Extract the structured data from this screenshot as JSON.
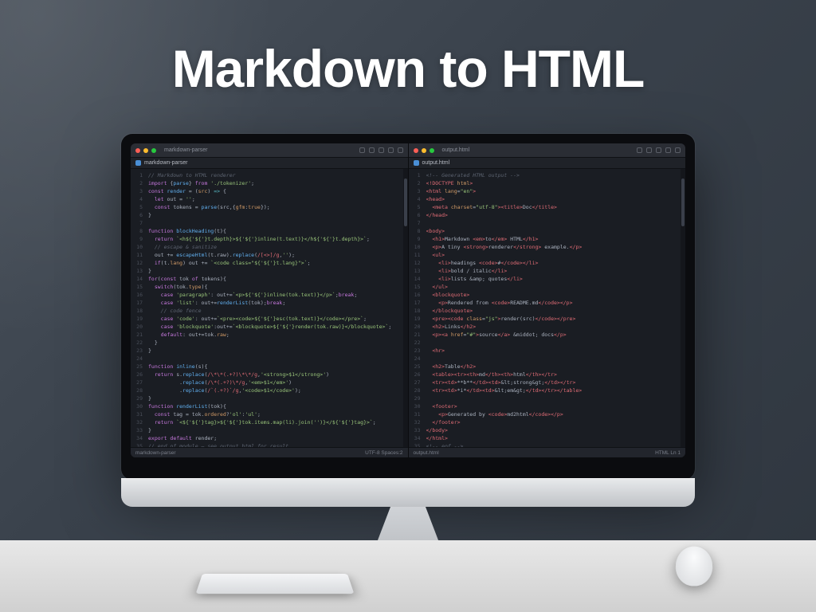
{
  "hero_title": "Markdown to HTML",
  "left_pane": {
    "tab_label": "markdown-parser",
    "status_left": "markdown-parser",
    "status_right": "UTF-8  Spaces:2",
    "lines": [
      {
        "n": 1,
        "t": "<span class='cm'>// Markdown to HTML renderer</span>"
      },
      {
        "n": 2,
        "t": "<span class='kw'>import</span> {<span class='fn'>parse</span>} <span class='kw'>from</span> <span class='str'>'./tokenizer'</span>;"
      },
      {
        "n": 3,
        "t": "<span class='kw'>const</span> <span class='fn'>render</span> = (<span class='attr'>src</span>) <span class='op'>=&gt;</span> {"
      },
      {
        "n": 4,
        "t": "  <span class='kw'>let</span> out = <span class='str'>''</span>;"
      },
      {
        "n": 5,
        "t": "  <span class='kw'>const</span> tokens = <span class='fn'>parse</span>(src,{<span class='attr'>gfm</span>:<span class='num'>true</span>});"
      },
      {
        "n": 6,
        "t": "}"
      },
      {
        "n": 7,
        "t": ""
      },
      {
        "n": 8,
        "t": "<span class='kw'>function</span> <span class='fn'>blockHeading</span>(t){"
      },
      {
        "n": 9,
        "t": "  <span class='kw'>return</span> <span class='str'>`&lt;h${'${'}t.depth}&gt;${'${'}inline(t.text)}&lt;/h${'${'}t.depth}&gt;`</span>;"
      },
      {
        "n": 10,
        "t": "  <span class='cm'>// escape &amp; sanitize</span>"
      },
      {
        "n": 11,
        "t": "  out += <span class='fn'>escapeHtml</span>(t.raw).<span class='fn'>replace</span>(<span class='tag'>/[&lt;&gt;]/g</span>,<span class='str'>''</span>);"
      },
      {
        "n": 12,
        "t": "  <span class='kw'>if</span>(t.<span class='attr'>lang</span>) out += <span class='str'>`&lt;code class=&quot;${'${'}t.lang}&quot;&gt;`</span>;"
      },
      {
        "n": 13,
        "t": "}"
      },
      {
        "n": 14,
        "t": "<span class='kw'>for</span>(<span class='kw'>const</span> tok <span class='kw'>of</span> tokens){"
      },
      {
        "n": 15,
        "t": "  <span class='kw'>switch</span>(tok.<span class='attr'>type</span>){"
      },
      {
        "n": 16,
        "t": "    <span class='kw'>case</span> <span class='str'>'paragraph'</span>: out+=<span class='str'>`&lt;p&gt;${'${'}inline(tok.text)}&lt;/p&gt;`</span>;<span class='kw'>break</span>;"
      },
      {
        "n": 17,
        "t": "    <span class='kw'>case</span> <span class='str'>'list'</span>: out+=<span class='fn'>renderList</span>(tok);<span class='kw'>break</span>;"
      },
      {
        "n": 18,
        "t": "    <span class='cm'>// code fence</span>"
      },
      {
        "n": 19,
        "t": "    <span class='kw'>case</span> <span class='str'>'code'</span>: out+=<span class='str'>`&lt;pre&gt;&lt;code&gt;${'${'}esc(tok.text)}&lt;/code&gt;&lt;/pre&gt;`</span>;"
      },
      {
        "n": 20,
        "t": "    <span class='kw'>case</span> <span class='str'>'blockquote'</span>:out+=<span class='str'>`&lt;blockquote&gt;${'${'}render(tok.raw)}&lt;/blockquote&gt;`</span>;"
      },
      {
        "n": 21,
        "t": "    <span class='kw'>default</span>: out+=tok.<span class='attr'>raw</span>;"
      },
      {
        "n": 22,
        "t": "  }"
      },
      {
        "n": 23,
        "t": "}"
      },
      {
        "n": 24,
        "t": ""
      },
      {
        "n": 25,
        "t": "<span class='kw'>function</span> <span class='fn'>inline</span>(s){"
      },
      {
        "n": 26,
        "t": "  <span class='kw'>return</span> s.<span class='fn'>replace</span>(<span class='tag'>/\\*\\*(.+?)\\*\\*/g</span>,<span class='str'>'&lt;strong&gt;$1&lt;/strong&gt;'</span>)"
      },
      {
        "n": 27,
        "t": "          .<span class='fn'>replace</span>(<span class='tag'>/\\*(.+?)\\*/g</span>,<span class='str'>'&lt;em&gt;$1&lt;/em&gt;'</span>)"
      },
      {
        "n": 28,
        "t": "          .<span class='fn'>replace</span>(<span class='tag'>/`(.+?)`/g</span>,<span class='str'>'&lt;code&gt;$1&lt;/code&gt;'</span>);"
      },
      {
        "n": 29,
        "t": "}"
      },
      {
        "n": 30,
        "t": "<span class='kw'>function</span> <span class='fn'>renderList</span>(tok){"
      },
      {
        "n": 31,
        "t": "  <span class='kw'>const</span> tag = tok.<span class='attr'>ordered</span>?<span class='str'>'ol'</span>:<span class='str'>'ul'</span>;"
      },
      {
        "n": 32,
        "t": "  <span class='kw'>return</span> <span class='str'>`&lt;${'${'}tag}&gt;${'${'}tok.items.map(li).join('')}&lt;/${'${'}tag}&gt;`</span>;"
      },
      {
        "n": 33,
        "t": "}"
      },
      {
        "n": 34,
        "t": "<span class='kw'>export</span> <span class='kw'>default</span> render;"
      },
      {
        "n": 35,
        "t": "<span class='cm'>// end of module — see output.html for result</span>"
      }
    ]
  },
  "right_pane": {
    "tab_label": "output.html",
    "status_left": "output.html",
    "status_right": "HTML  Ln 1",
    "lines": [
      {
        "n": 1,
        "t": "<span class='cm'>&lt;!-- Generated HTML output --&gt;</span>"
      },
      {
        "n": 2,
        "t": "<span class='tag'>&lt;!DOCTYPE</span> <span class='attr'>html</span><span class='tag'>&gt;</span>"
      },
      {
        "n": 3,
        "t": "<span class='tag'>&lt;html</span> <span class='attr'>lang</span>=<span class='str'>&quot;en&quot;</span><span class='tag'>&gt;</span>"
      },
      {
        "n": 4,
        "t": "<span class='tag'>&lt;head&gt;</span>"
      },
      {
        "n": 5,
        "t": "  <span class='tag'>&lt;meta</span> <span class='attr'>charset</span>=<span class='str'>&quot;utf-8&quot;</span><span class='tag'>&gt;</span><span class='tag'>&lt;title&gt;</span>Doc<span class='tag'>&lt;/title&gt;</span>"
      },
      {
        "n": 6,
        "t": "<span class='tag'>&lt;/head&gt;</span>"
      },
      {
        "n": 7,
        "t": ""
      },
      {
        "n": 8,
        "t": "<span class='tag'>&lt;body&gt;</span>"
      },
      {
        "n": 9,
        "t": "  <span class='tag'>&lt;h1&gt;</span>Markdown <span class='tag'>&lt;em&gt;</span>to<span class='tag'>&lt;/em&gt;</span> HTML<span class='tag'>&lt;/h1&gt;</span>"
      },
      {
        "n": 10,
        "t": "  <span class='tag'>&lt;p&gt;</span>A tiny <span class='tag'>&lt;strong&gt;</span>renderer<span class='tag'>&lt;/strong&gt;</span> example.<span class='tag'>&lt;/p&gt;</span>"
      },
      {
        "n": 11,
        "t": "  <span class='tag'>&lt;ul&gt;</span>"
      },
      {
        "n": 12,
        "t": "    <span class='tag'>&lt;li&gt;</span>headings <span class='tag'>&lt;code&gt;</span>#<span class='tag'>&lt;/code&gt;</span><span class='tag'>&lt;/li&gt;</span>"
      },
      {
        "n": 13,
        "t": "    <span class='tag'>&lt;li&gt;</span>bold / italic<span class='tag'>&lt;/li&gt;</span>"
      },
      {
        "n": 14,
        "t": "    <span class='tag'>&lt;li&gt;</span>lists &amp;amp; quotes<span class='tag'>&lt;/li&gt;</span>"
      },
      {
        "n": 15,
        "t": "  <span class='tag'>&lt;/ul&gt;</span>"
      },
      {
        "n": 16,
        "t": "  <span class='tag'>&lt;blockquote&gt;</span>"
      },
      {
        "n": 17,
        "t": "    <span class='tag'>&lt;p&gt;</span>Rendered from <span class='tag'>&lt;code&gt;</span>README.md<span class='tag'>&lt;/code&gt;</span><span class='tag'>&lt;/p&gt;</span>"
      },
      {
        "n": 18,
        "t": "  <span class='tag'>&lt;/blockquote&gt;</span>"
      },
      {
        "n": 19,
        "t": "  <span class='tag'>&lt;pre&gt;&lt;code</span> <span class='attr'>class</span>=<span class='str'>&quot;js&quot;</span><span class='tag'>&gt;</span>render(src)<span class='tag'>&lt;/code&gt;&lt;/pre&gt;</span>"
      },
      {
        "n": 20,
        "t": "  <span class='tag'>&lt;h2&gt;</span>Links<span class='tag'>&lt;/h2&gt;</span>"
      },
      {
        "n": 21,
        "t": "  <span class='tag'>&lt;p&gt;&lt;a</span> <span class='attr'>href</span>=<span class='str'>&quot;#&quot;</span><span class='tag'>&gt;</span>source<span class='tag'>&lt;/a&gt;</span> &amp;middot; docs<span class='tag'>&lt;/p&gt;</span>"
      },
      {
        "n": 22,
        "t": ""
      },
      {
        "n": 23,
        "t": "  <span class='tag'>&lt;hr&gt;</span>"
      },
      {
        "n": 24,
        "t": ""
      },
      {
        "n": 25,
        "t": "  <span class='tag'>&lt;h2&gt;</span>Table<span class='tag'>&lt;/h2&gt;</span>"
      },
      {
        "n": 26,
        "t": "  <span class='tag'>&lt;table&gt;&lt;tr&gt;&lt;th&gt;</span>md<span class='tag'>&lt;/th&gt;&lt;th&gt;</span>html<span class='tag'>&lt;/th&gt;&lt;/tr&gt;</span>"
      },
      {
        "n": 27,
        "t": "  <span class='tag'>&lt;tr&gt;&lt;td&gt;</span>**b**<span class='tag'>&lt;/td&gt;&lt;td&gt;</span>&amp;lt;strong&amp;gt;<span class='tag'>&lt;/td&gt;&lt;/tr&gt;</span>"
      },
      {
        "n": 28,
        "t": "  <span class='tag'>&lt;tr&gt;&lt;td&gt;</span>*i*<span class='tag'>&lt;/td&gt;&lt;td&gt;</span>&amp;lt;em&amp;gt;<span class='tag'>&lt;/td&gt;&lt;/tr&gt;&lt;/table&gt;</span>"
      },
      {
        "n": 29,
        "t": ""
      },
      {
        "n": 30,
        "t": "  <span class='tag'>&lt;footer&gt;</span>"
      },
      {
        "n": 31,
        "t": "    <span class='tag'>&lt;p&gt;</span>Generated by <span class='tag'>&lt;code&gt;</span>md2html<span class='tag'>&lt;/code&gt;</span><span class='tag'>&lt;/p&gt;</span>"
      },
      {
        "n": 32,
        "t": "  <span class='tag'>&lt;/footer&gt;</span>"
      },
      {
        "n": 33,
        "t": "<span class='tag'>&lt;/body&gt;</span>"
      },
      {
        "n": 34,
        "t": "<span class='tag'>&lt;/html&gt;</span>"
      },
      {
        "n": 35,
        "t": "<span class='cm'>&lt;!-- eof --&gt;</span>"
      }
    ]
  }
}
